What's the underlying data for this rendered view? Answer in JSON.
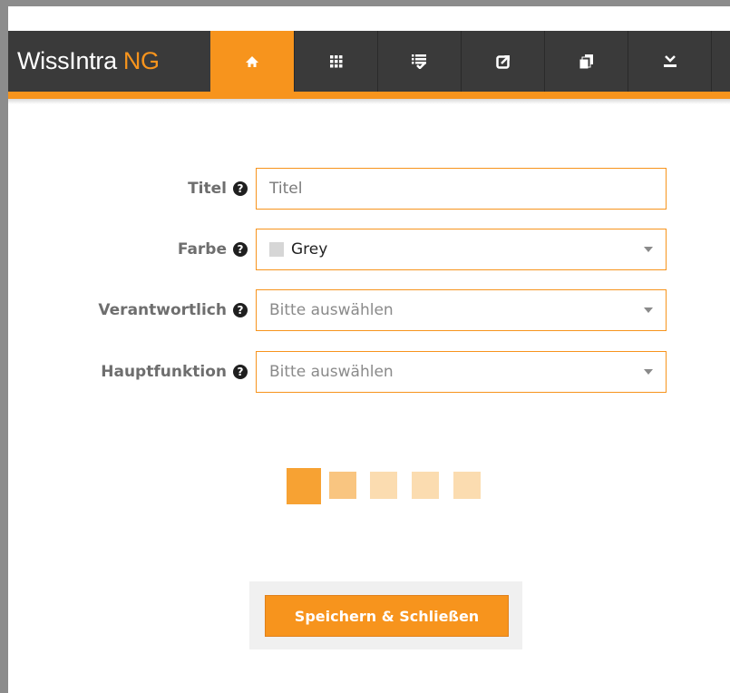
{
  "header": {
    "brand_name": "WissIntra",
    "brand_suffix": "NG",
    "nav_items": [
      {
        "icon": "home-icon",
        "active": true
      },
      {
        "icon": "grid-icon",
        "active": false
      },
      {
        "icon": "checklist-icon",
        "active": false
      },
      {
        "icon": "external-link-icon",
        "active": false
      },
      {
        "icon": "documents-icon",
        "active": false
      },
      {
        "icon": "download-icon",
        "active": false
      }
    ]
  },
  "form": {
    "help_glyph": "?",
    "title": {
      "label": "Titel",
      "placeholder": "Titel",
      "value": ""
    },
    "color": {
      "label": "Farbe",
      "value": "Grey",
      "swatch_color": "#d6d6d6"
    },
    "responsible": {
      "label": "Verantwortlich",
      "placeholder": "Bitte auswählen"
    },
    "main_function": {
      "label": "Hauptfunktion",
      "placeholder": "Bitte auswählen"
    }
  },
  "progress": {
    "current_step": 1,
    "total_steps": 5
  },
  "footer": {
    "save_button_label": "Speichern & Schließen"
  },
  "colors": {
    "accent": "#f7941d",
    "navbar": "#3a3a3a",
    "label": "#6e6e6e"
  }
}
